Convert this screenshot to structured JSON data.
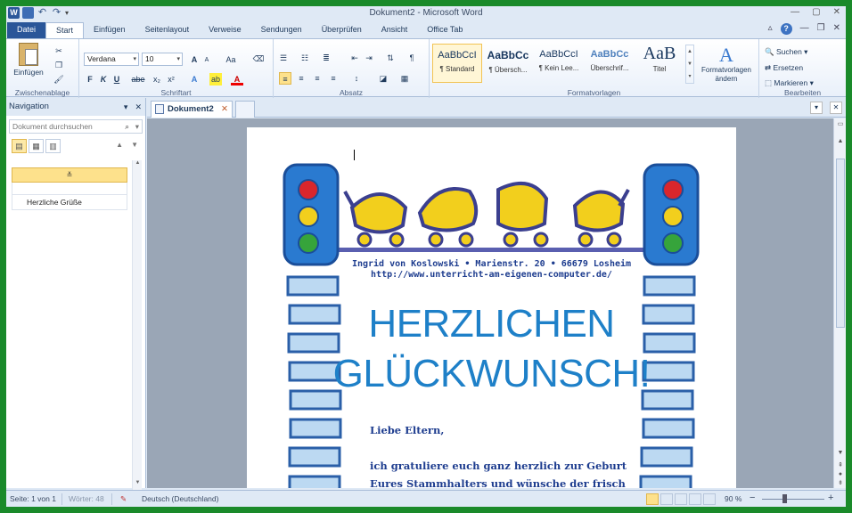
{
  "window": {
    "title": "Dokument2 - Microsoft Word",
    "word_icon": "W",
    "undo_icon": "↶",
    "redo_icon": "↷"
  },
  "tabs": {
    "file": "Datei",
    "items": [
      "Start",
      "Einfügen",
      "Seitenlayout",
      "Verweise",
      "Sendungen",
      "Überprüfen",
      "Ansicht",
      "Office Tab"
    ],
    "active": "Start"
  },
  "ribbon": {
    "clipboard": {
      "paste": "Einfügen",
      "label": "Zwischenablage"
    },
    "font": {
      "name": "Verdana",
      "size": "10",
      "label": "Schriftart",
      "bold": "F",
      "italic": "K",
      "underline": "U",
      "strike": "abe",
      "subscript": "x₂",
      "superscript": "x²",
      "grow": "A",
      "shrink": "A",
      "case": "Aa"
    },
    "paragraph": {
      "label": "Absatz",
      "pilcrow": "¶"
    },
    "styles": {
      "label": "Formatvorlagen",
      "items": [
        {
          "preview": "AaBbCcI",
          "name": "¶ Standard"
        },
        {
          "preview": "AaBbCc",
          "name": "¶ Übersch..."
        },
        {
          "preview": "AaBbCcI",
          "name": "¶ Kein Lee..."
        },
        {
          "preview": "AaBbCc",
          "name": "Überschrif..."
        },
        {
          "preview": "AaB",
          "name": "Titel"
        }
      ],
      "change": "Formatvorlagen ändern"
    },
    "editing": {
      "label": "Bearbeiten",
      "find": "Suchen",
      "replace": "Ersetzen",
      "select": "Markieren"
    }
  },
  "navigation": {
    "title": "Navigation",
    "search_placeholder": "Dokument durchsuchen",
    "headings": [
      "Herzliche Grüße"
    ],
    "collapse_glyph": "≚"
  },
  "document": {
    "tab_name": "Dokument2",
    "letterhead_line1": "Ingrid von Koslowski • Marienstr. 20 •  66679 Losheim",
    "letterhead_line2": "http://www.unterricht-am-eigenen-computer.de/",
    "title_line1": "HERZLICHEN",
    "title_line2": "GLÜCKWUNSCH!",
    "greeting": "Liebe Eltern,",
    "body_line1": "ich gratuliere euch ganz herzlich zur Geburt",
    "body_line2": "Eures Stammhalters  und wünsche  der frisch"
  },
  "status": {
    "page": "Seite: 1 von 1",
    "words": "Wörter: 48",
    "language": "Deutsch (Deutschland)",
    "zoom": "90 %",
    "zoom_minus": "−",
    "zoom_plus": "+"
  },
  "colors": {
    "frame": "#1a8a2a",
    "ribbon_file": "#2a5699",
    "title_text": "#1e80c8",
    "body_text": "#1e3d8f",
    "traffic_light_body": "#2a7ad0",
    "pram_yellow": "#f2cf1d",
    "ladder_fill": "#bcd9f2"
  }
}
